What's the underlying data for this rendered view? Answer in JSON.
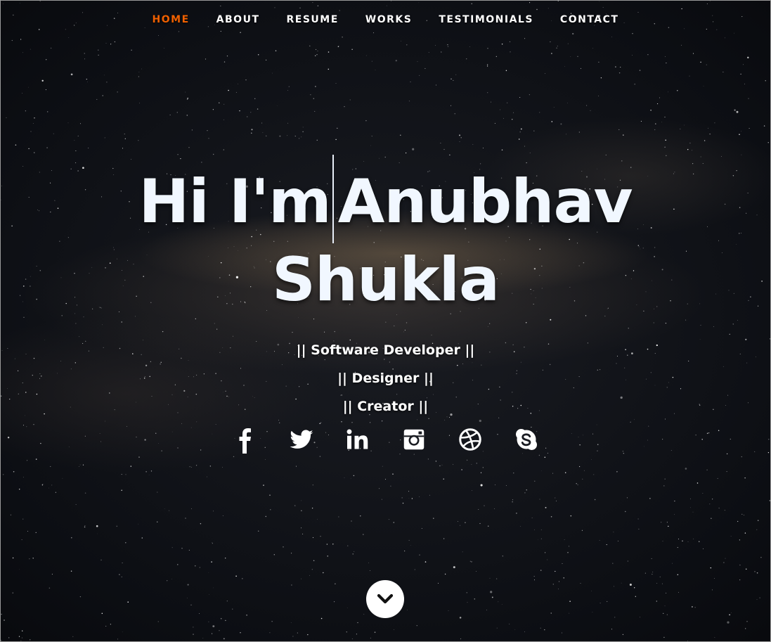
{
  "nav": {
    "items": [
      {
        "label": "HOME",
        "active": true
      },
      {
        "label": "ABOUT"
      },
      {
        "label": "RESUME"
      },
      {
        "label": "WORKS"
      },
      {
        "label": "TESTIMONIALS"
      },
      {
        "label": "CONTACT"
      }
    ],
    "active_color": "#f06000"
  },
  "hero": {
    "greeting": "Hi I'm",
    "first_name": "Anubhav",
    "last_name": "Shukla",
    "roles": [
      "|| Software Developer ||",
      "|| Designer ||",
      "|| Creator ||"
    ]
  },
  "social": {
    "icons": [
      "facebook-icon",
      "twitter-icon",
      "linkedin-icon",
      "instagram-icon",
      "dribbble-icon",
      "skype-icon"
    ]
  },
  "scroll": {
    "icon": "chevron-down-icon"
  }
}
